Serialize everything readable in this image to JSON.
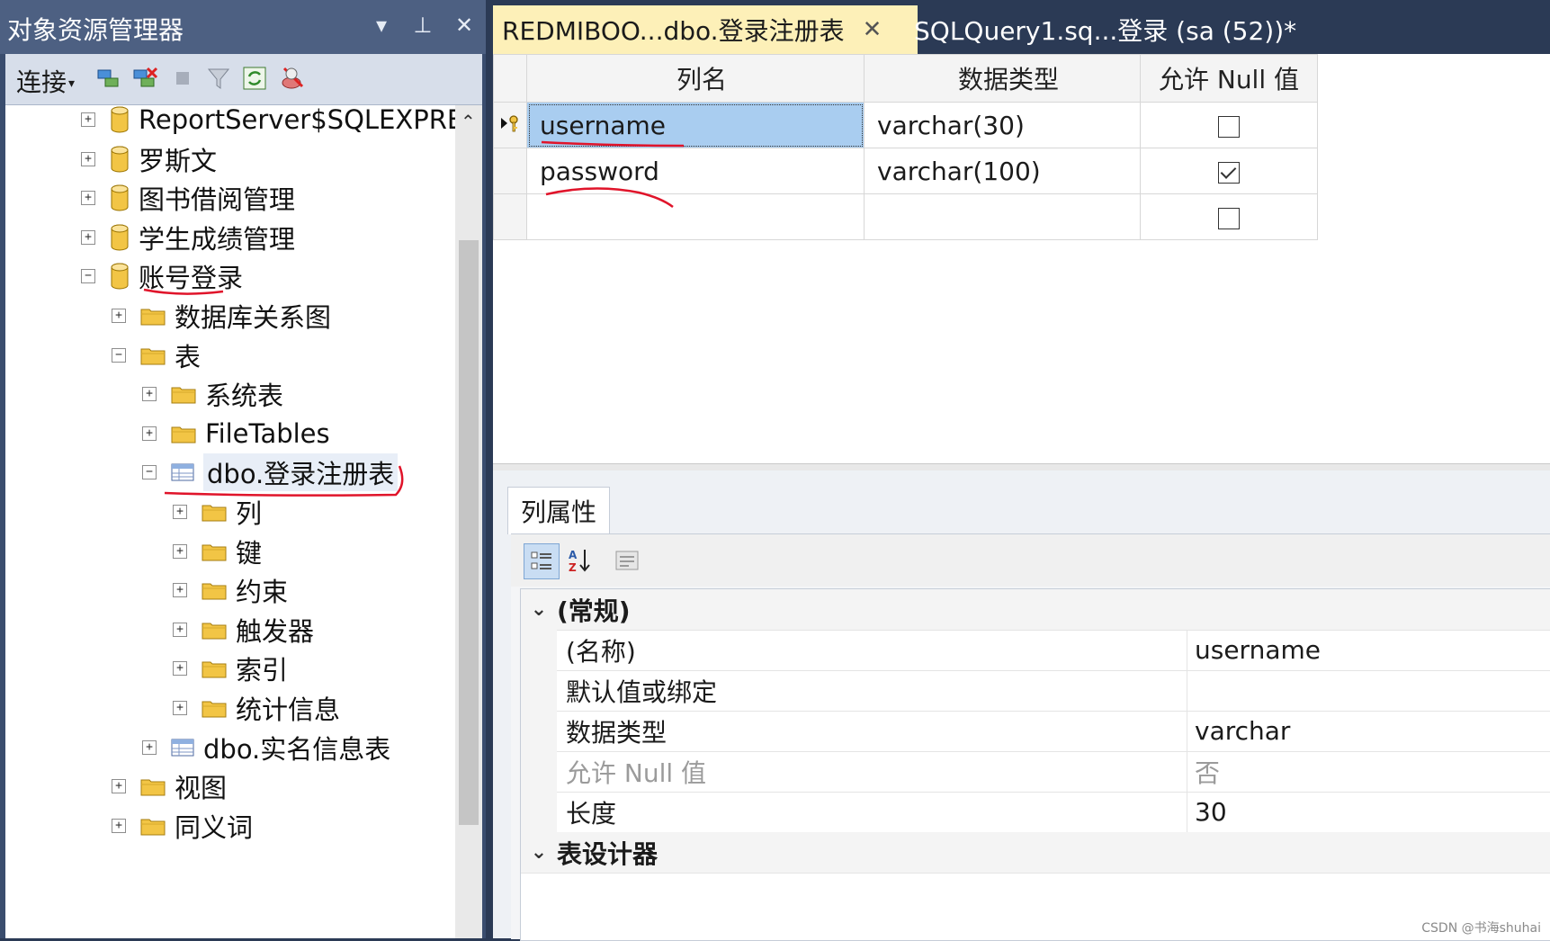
{
  "object_explorer": {
    "title": "对象资源管理器",
    "title_buttons": [
      "▾",
      "⊥",
      "✕"
    ],
    "toolbar": {
      "connect_label": "连接",
      "caret": "▾"
    },
    "tree": [
      {
        "label": "ReportServer$SQLEXPRES",
        "icon": "database-icon",
        "expander": "+",
        "level": 0
      },
      {
        "label": "罗斯文",
        "icon": "database-icon",
        "expander": "+",
        "level": 0
      },
      {
        "label": "图书借阅管理",
        "icon": "database-icon",
        "expander": "+",
        "level": 0
      },
      {
        "label": "学生成绩管理",
        "icon": "database-icon",
        "expander": "+",
        "level": 0
      },
      {
        "label": "账号登录",
        "icon": "database-icon",
        "expander": "−",
        "level": 0
      },
      {
        "label": "数据库关系图",
        "icon": "folder-icon",
        "expander": "+",
        "level": 1
      },
      {
        "label": "表",
        "icon": "folder-icon",
        "expander": "−",
        "level": 1
      },
      {
        "label": "系统表",
        "icon": "folder-icon",
        "expander": "+",
        "level": 2
      },
      {
        "label": "FileTables",
        "icon": "folder-icon",
        "expander": "+",
        "level": 2
      },
      {
        "label": "dbo.登录注册表",
        "icon": "table-icon",
        "expander": "−",
        "level": 2
      },
      {
        "label": "列",
        "icon": "folder-icon",
        "expander": "+",
        "level": 3
      },
      {
        "label": "键",
        "icon": "folder-icon",
        "expander": "+",
        "level": 3
      },
      {
        "label": "约束",
        "icon": "folder-icon",
        "expander": "+",
        "level": 3
      },
      {
        "label": "触发器",
        "icon": "folder-icon",
        "expander": "+",
        "level": 3
      },
      {
        "label": "索引",
        "icon": "folder-icon",
        "expander": "+",
        "level": 3
      },
      {
        "label": "统计信息",
        "icon": "folder-icon",
        "expander": "+",
        "level": 3
      },
      {
        "label": "dbo.实名信息表",
        "icon": "table-icon",
        "expander": "+",
        "level": 2
      },
      {
        "label": "视图",
        "icon": "folder-icon",
        "expander": "+",
        "level": 1
      },
      {
        "label": "同义词",
        "icon": "folder-icon",
        "expander": "+",
        "level": 1
      }
    ]
  },
  "tabs": [
    {
      "label": "REDMIBOO...dbo.登录注册表",
      "close": "✕"
    },
    {
      "label": "SQLQuery1.sq...登录 (sa (52))*"
    }
  ],
  "designer": {
    "headers": [
      "列名",
      "数据类型",
      "允许 Null 值"
    ],
    "rows": [
      {
        "name": "username",
        "type": "varchar(30)",
        "allow_null": false
      },
      {
        "name": "password",
        "type": "varchar(100)",
        "allow_null": true
      },
      {
        "name": "",
        "type": "",
        "allow_null": false
      }
    ]
  },
  "column_properties": {
    "tab_label": "列属性",
    "category": "(常规)",
    "rows": [
      {
        "name": "(名称)",
        "value": "username"
      },
      {
        "name": "默认值或绑定",
        "value": ""
      },
      {
        "name": "数据类型",
        "value": "varchar"
      },
      {
        "name": "允许 Null 值",
        "value": "否"
      },
      {
        "name": "长度",
        "value": "30"
      }
    ],
    "next_category": "表设计器"
  },
  "watermark": "CSDN @书海shuhai",
  "colors": {
    "accent_tab": "#fdf0b8",
    "selection": "#a9cdf0",
    "annotation": "#e0142a",
    "folder": "#f2c545"
  }
}
